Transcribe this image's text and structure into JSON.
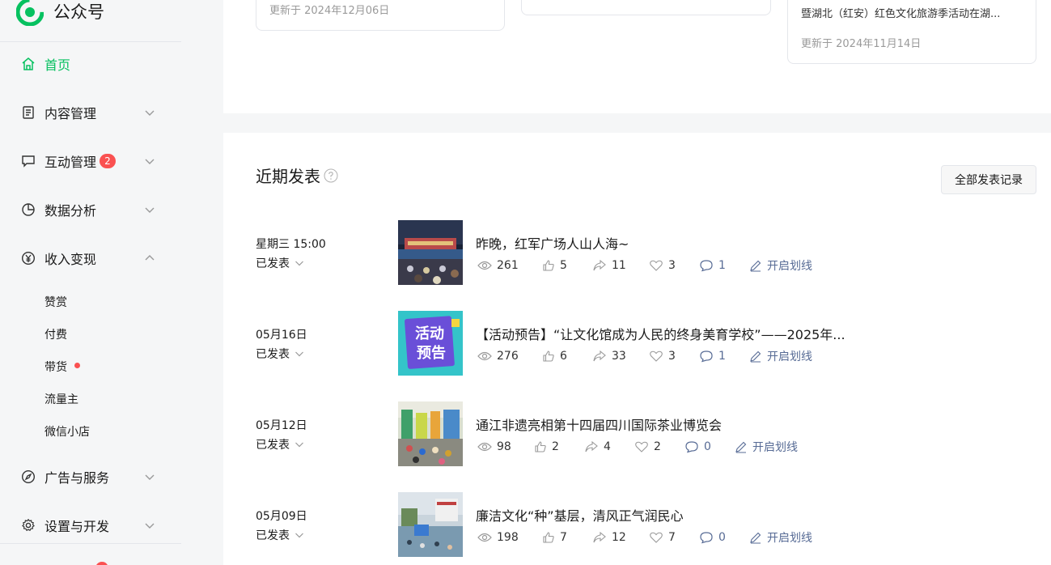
{
  "brand": {
    "name": "公众号",
    "color": "#07c160"
  },
  "sidebar": {
    "items": [
      {
        "label": "首页",
        "icon": "home-icon",
        "active": true
      },
      {
        "label": "内容管理",
        "icon": "document-icon"
      },
      {
        "label": "互动管理",
        "icon": "chat-icon",
        "badge": "2"
      },
      {
        "label": "数据分析",
        "icon": "pie-chart-icon"
      },
      {
        "label": "收入变现",
        "icon": "yen-icon",
        "expanded": true
      },
      {
        "label": "广告与服务",
        "icon": "compass-icon"
      },
      {
        "label": "设置与开发",
        "icon": "gear-icon"
      }
    ],
    "sub_items": [
      {
        "label": "赞赏"
      },
      {
        "label": "付费"
      },
      {
        "label": "带货",
        "dot": true
      },
      {
        "label": "流量主"
      },
      {
        "label": "微信小店"
      }
    ]
  },
  "top_cards": [
    {
      "updated": "更新于 2024年12月06日"
    },
    {
      "updated": ""
    },
    {
      "title": "暨湖北（红安）红色文化旅游季活动在湖...",
      "updated": "更新于 2024年11月14日"
    }
  ],
  "recent": {
    "title": "近期发表",
    "all_button": "全部发表记录",
    "line_label": "开启划线",
    "posts": [
      {
        "date": "星期三 15:00",
        "status": "已发表",
        "title": "昨晚，红军广场人山人海~",
        "views": "261",
        "likes": "5",
        "shares": "11",
        "favs": "3",
        "comments": "1"
      },
      {
        "date": "05月16日",
        "status": "已发表",
        "title": "【活动预告】“让文化馆成为人民的终身美育学校”——2025年...",
        "views": "276",
        "likes": "6",
        "shares": "33",
        "favs": "3",
        "comments": "1",
        "thumb_text_1": "活动",
        "thumb_text_2": "预告"
      },
      {
        "date": "05月12日",
        "status": "已发表",
        "title": "通江非遗亮相第十四届四川国际茶业博览会",
        "views": "98",
        "likes": "2",
        "shares": "4",
        "favs": "2",
        "comments": "0"
      },
      {
        "date": "05月09日",
        "status": "已发表",
        "title": "廉洁文化“种”基层，清风正气润民心",
        "views": "198",
        "likes": "7",
        "shares": "12",
        "favs": "7",
        "comments": "0"
      }
    ]
  }
}
